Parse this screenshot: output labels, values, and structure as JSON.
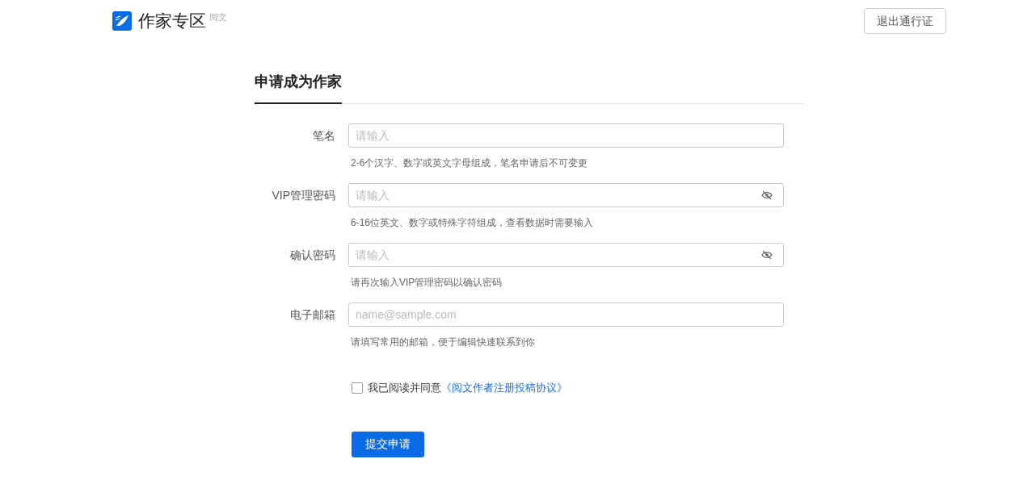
{
  "header": {
    "logo_text": "作家专区",
    "logo_sub": "阅文",
    "logout_button": "退出通行证"
  },
  "form": {
    "title": "申请成为作家",
    "fields": [
      {
        "label": "笔名",
        "kind": "text",
        "placeholder": "请输入",
        "hint": "2-6个汉字、数字或英文字母组成，笔名申请后不可变更"
      },
      {
        "label": "VIP管理密码",
        "kind": "password",
        "placeholder": "请输入",
        "hint": "6-16位英文、数字或特殊字符组成，查看数据时需要输入"
      },
      {
        "label": "确认密码",
        "kind": "password",
        "placeholder": "请输入",
        "hint": "请再次输入VIP管理密码以确认密码"
      },
      {
        "label": "电子邮箱",
        "kind": "text",
        "placeholder": "name@sample.com",
        "hint": "请填写常用的邮箱，便于编辑快速联系到你"
      }
    ],
    "agreement": {
      "checked": false,
      "text": "我已阅读并同意",
      "link": "《阅文作者注册投稿协议》"
    },
    "submit_button": "提交申请"
  }
}
